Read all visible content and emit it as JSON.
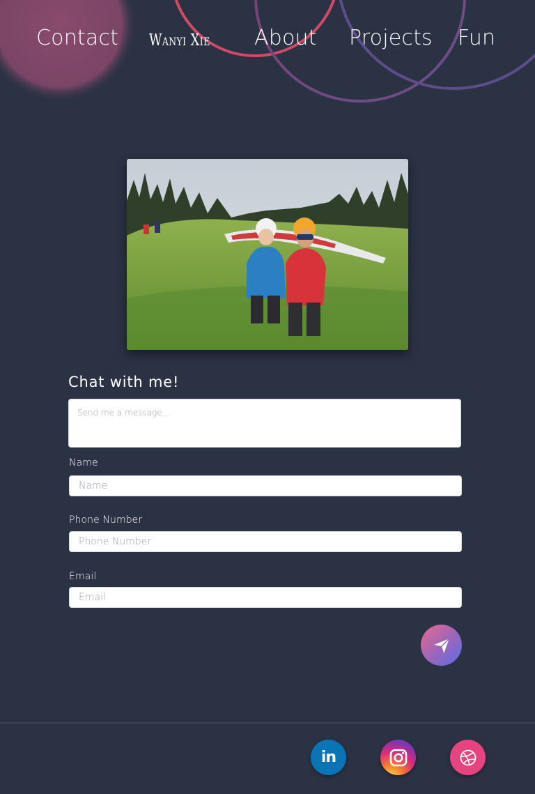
{
  "nav": {
    "contact": "Contact",
    "brand": "Wanyi Xie",
    "about": "About",
    "projects": "Projects",
    "fun": "Fun"
  },
  "photo": {
    "description_icon": "paragliding-photo"
  },
  "form": {
    "title": "Chat with me!",
    "message_placeholder": "Send me a message...",
    "name_label": "Name",
    "name_placeholder": "Name",
    "phone_label": "Phone Number",
    "phone_placeholder": "Phone Number",
    "email_label": "Email",
    "email_placeholder": "Email",
    "send_icon": "paper-plane-icon"
  },
  "footer": {
    "social": [
      {
        "icon": "linkedin-icon",
        "color": "#0a74b5"
      },
      {
        "icon": "instagram-icon",
        "color": "#c13584"
      },
      {
        "icon": "dribbble-icon",
        "color": "#e6447f"
      }
    ]
  },
  "colors": {
    "background": "#2b3243",
    "accent_pink": "#d9486a",
    "accent_purple": "#6a4f8c"
  }
}
